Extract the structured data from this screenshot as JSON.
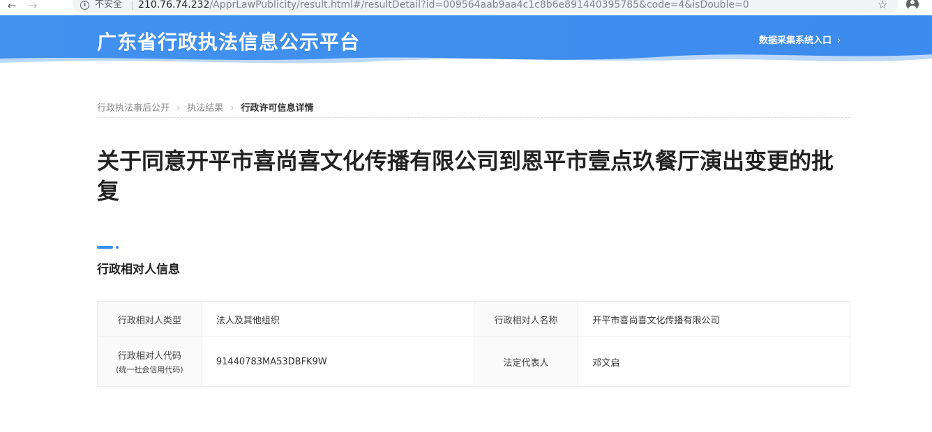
{
  "browser": {
    "security_label": "不安全",
    "url_host": "210.76.74.232",
    "url_path": "/ApprLawPublicity/result.html#/resultDetail?id=009564aab9aa4c1c8b6e891440395785&code=4&isDouble=0"
  },
  "header": {
    "site_title": "广东省行政执法信息公示平台",
    "data_entry_link": "数据采集系统入口",
    "banner_color": "#4191ef"
  },
  "breadcrumb": {
    "items": [
      "行政执法事后公开",
      "执法结果"
    ],
    "current": "行政许可信息详情"
  },
  "page": {
    "title": "关于同意开平市喜尚喜文化传播有限公司到恩平市壹点玖餐厅演出变更的批复"
  },
  "section": {
    "title": "行政相对人信息",
    "accent_color": "#3d8ef0"
  },
  "info_table": {
    "type_label": "行政相对人类型",
    "type_value": "法人及其他组织",
    "name_label": "行政相对人名称",
    "name_value": "开平市喜尚喜文化传播有限公司",
    "code_label": "行政相对人代码",
    "code_sublabel": "(统一社会信用代码)",
    "code_value": "91440783MA53DBFK9W",
    "rep_label": "法定代表人",
    "rep_value": "邓文启"
  }
}
